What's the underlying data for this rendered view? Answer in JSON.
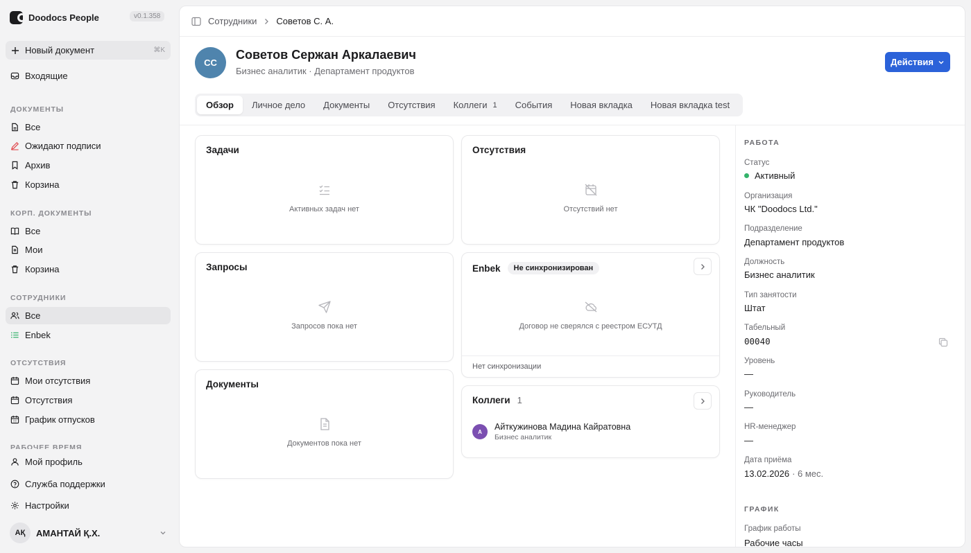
{
  "app": {
    "name": "Doodocs People",
    "version": "v0.1.358"
  },
  "sidebar": {
    "new_doc": {
      "label": "Новый документ",
      "shortcut": "⌘K"
    },
    "inbox": "Входящие",
    "sections": [
      {
        "title": "ДОКУМЕНТЫ",
        "items": [
          "Все",
          "Ожидают подписи",
          "Архив",
          "Корзина"
        ]
      },
      {
        "title": "КОРП. ДОКУМЕНТЫ",
        "items": [
          "Все",
          "Мои",
          "Корзина"
        ]
      },
      {
        "title": "СОТРУДНИКИ",
        "items": [
          "Все",
          "Enbek"
        ]
      },
      {
        "title": "ОТСУТСТВИЯ",
        "items": [
          "Мои отсутствия",
          "Отсутствия",
          "График отпусков"
        ]
      },
      {
        "title": "РАБОЧЕЕ ВРЕМЯ",
        "items": []
      }
    ],
    "footer": [
      "Мой профиль",
      "Служба поддержки",
      "Настройки"
    ],
    "user": {
      "initials": "АҚ",
      "name": "АМАНТАЙ Қ.Х."
    }
  },
  "breadcrumb": {
    "parent": "Сотрудники",
    "current": "Советов С. А."
  },
  "profile": {
    "initials": "СС",
    "name": "Советов Сержан Аркалаевич",
    "subtitle": "Бизнес аналитик · Департамент продуктов",
    "actions_label": "Действия"
  },
  "tabs": [
    {
      "label": "Обзор"
    },
    {
      "label": "Личное дело"
    },
    {
      "label": "Документы"
    },
    {
      "label": "Отсутствия"
    },
    {
      "label": "Коллеги",
      "count": "1"
    },
    {
      "label": "События"
    },
    {
      "label": "Новая вкладка"
    },
    {
      "label": "Новая вкладка test"
    }
  ],
  "cards": {
    "tasks": {
      "title": "Задачи",
      "empty": "Активных задач нет"
    },
    "requests": {
      "title": "Запросы",
      "empty": "Запросов пока нет"
    },
    "documents": {
      "title": "Документы",
      "empty": "Документов пока нет"
    },
    "absences": {
      "title": "Отсутствия",
      "empty": "Отсутствий нет"
    },
    "enbek": {
      "title": "Enbek",
      "badge": "Не синхронизирован",
      "empty": "Договор не сверялся с реестром ЕСУТД",
      "footer": "Нет синхронизации"
    },
    "colleagues": {
      "title": "Коллеги",
      "count": "1",
      "items": [
        {
          "initial": "А",
          "name": "Айткужинова Мадина Кайратовна",
          "role": "Бизнес аналитик"
        }
      ]
    }
  },
  "details": {
    "work_title": "РАБОТА",
    "fields": [
      {
        "label": "Статус",
        "value": "Активный"
      },
      {
        "label": "Организация",
        "value": "ЧК \"Doodocs Ltd.\""
      },
      {
        "label": "Подразделение",
        "value": "Департамент продуктов"
      },
      {
        "label": "Должность",
        "value": "Бизнес аналитик"
      },
      {
        "label": "Тип занятости",
        "value": "Штат"
      },
      {
        "label": "Табельный",
        "value": "00040"
      },
      {
        "label": "Уровень",
        "value": "—"
      },
      {
        "label": "Руководитель",
        "value": "—"
      },
      {
        "label": "HR-менеджер",
        "value": "—"
      },
      {
        "label": "Дата приёма",
        "value": "13.02.2026",
        "extra": "· 6 мес."
      }
    ],
    "schedule_title": "ГРАФИК",
    "schedule": {
      "label": "График работы",
      "value": "Рабочие часы"
    },
    "status_color": "#34b36b"
  },
  "colors": {
    "accent": "#2b62d9",
    "avatar": "#4f84ad",
    "colleague_avatar": "#7b4fb1",
    "danger_icon": "#e0474c",
    "enbek_icon": "#34b36b"
  }
}
